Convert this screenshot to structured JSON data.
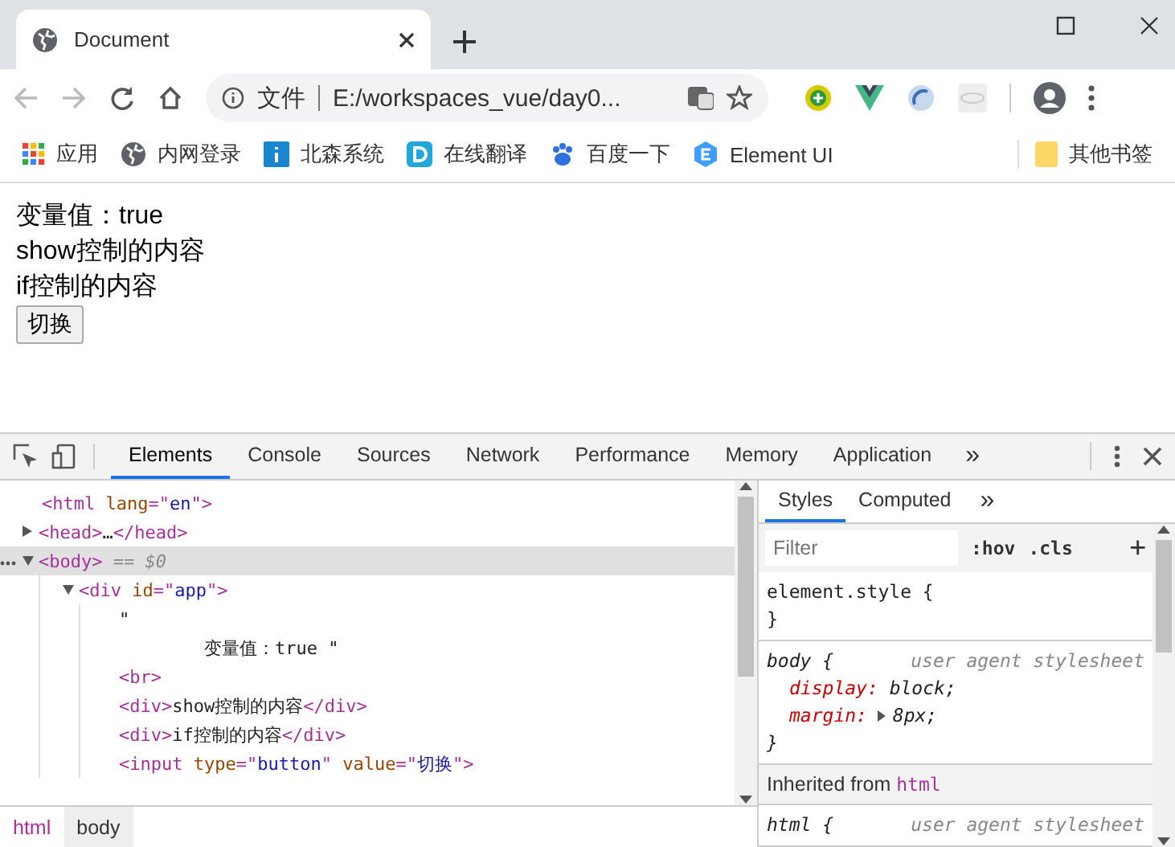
{
  "browser_tab": {
    "title": "Document"
  },
  "address_bar": {
    "scheme_label": "文件",
    "url": "E:/workspaces_vue/day0..."
  },
  "bookmarks": [
    {
      "kind": "apps",
      "label": "应用"
    },
    {
      "kind": "globe",
      "label": "内网登录"
    },
    {
      "kind": "info",
      "label": "北森系统"
    },
    {
      "kind": "letter-d",
      "label": "在线翻译"
    },
    {
      "kind": "paw",
      "label": "百度一下"
    },
    {
      "kind": "hex",
      "label": "Element UI"
    }
  ],
  "other_bookmarks": {
    "label": "其他书签"
  },
  "page": {
    "lines": [
      "变量值：true",
      "show控制的内容",
      "if控制的内容"
    ],
    "button": "切换"
  },
  "devtools": {
    "tabs": [
      {
        "label": "Elements",
        "selected": true
      },
      {
        "label": "Console",
        "selected": false
      },
      {
        "label": "Sources",
        "selected": false
      },
      {
        "label": "Network",
        "selected": false
      },
      {
        "label": "Performance",
        "selected": false
      },
      {
        "label": "Memory",
        "selected": false
      },
      {
        "label": "Application",
        "selected": false
      }
    ],
    "more_tabs": "»",
    "dom_tree": [
      {
        "parts": [
          {
            "kind": "tag",
            "text": "<html "
          },
          {
            "kind": "attr",
            "text": "lang"
          },
          {
            "kind": "tag",
            "text": "=\""
          },
          {
            "kind": "value",
            "text": "en"
          },
          {
            "kind": "tag",
            "text": "\">"
          }
        ],
        "selected": false,
        "children": [
          {
            "parts": [
              {
                "kind": "tag",
                "text": "<head>"
              },
              {
                "kind": "text",
                "text": "…"
              },
              {
                "kind": "tag",
                "text": "</head>"
              }
            ],
            "expanded": false,
            "selected": false
          },
          {
            "parts": [
              {
                "kind": "tag",
                "text": "<body>"
              },
              {
                "kind": "marker",
                "text": " == $0"
              }
            ],
            "expanded": true,
            "selected": true,
            "children": [
              {
                "parts": [
                  {
                    "kind": "tag",
                    "text": "<div "
                  },
                  {
                    "kind": "attr",
                    "text": "id"
                  },
                  {
                    "kind": "tag",
                    "text": "=\""
                  },
                  {
                    "kind": "value",
                    "text": "app"
                  },
                  {
                    "kind": "tag",
                    "text": "\">"
                  }
                ],
                "expanded": true,
                "selected": false,
                "children": [
                  {
                    "parts": [
                      {
                        "kind": "text",
                        "text": "\""
                      }
                    ],
                    "selected": false
                  },
                  {
                    "parts": [
                      {
                        "kind": "text",
                        "text": "        变量值：true \""
                      }
                    ],
                    "selected": false
                  },
                  {
                    "parts": [
                      {
                        "kind": "tag",
                        "text": "<br>"
                      }
                    ],
                    "selected": false
                  },
                  {
                    "parts": [
                      {
                        "kind": "tag",
                        "text": "<div>"
                      },
                      {
                        "kind": "text",
                        "text": "show控制的内容"
                      },
                      {
                        "kind": "tag",
                        "text": "</div>"
                      }
                    ],
                    "selected": false
                  },
                  {
                    "parts": [
                      {
                        "kind": "tag",
                        "text": "<div>"
                      },
                      {
                        "kind": "text",
                        "text": "if控制的内容"
                      },
                      {
                        "kind": "tag",
                        "text": "</div>"
                      }
                    ],
                    "selected": false
                  },
                  {
                    "parts": [
                      {
                        "kind": "tag",
                        "text": "<input "
                      },
                      {
                        "kind": "attr",
                        "text": "type"
                      },
                      {
                        "kind": "tag",
                        "text": "=\""
                      },
                      {
                        "kind": "value",
                        "text": "button"
                      },
                      {
                        "kind": "tag",
                        "text": "\" "
                      },
                      {
                        "kind": "attr",
                        "text": "value"
                      },
                      {
                        "kind": "tag",
                        "text": "=\""
                      },
                      {
                        "kind": "value",
                        "text": "切换"
                      },
                      {
                        "kind": "tag",
                        "text": "\">"
                      }
                    ],
                    "selected": false
                  }
                ]
              }
            ]
          }
        ]
      }
    ],
    "breadcrumbs": [
      {
        "label": "html",
        "selected": false
      },
      {
        "label": "body",
        "selected": true
      }
    ],
    "styles_tabs": [
      {
        "label": "Styles",
        "selected": true
      },
      {
        "label": "Computed",
        "selected": false
      }
    ],
    "styles_more": "»",
    "filter": {
      "placeholder": "Filter"
    },
    "filter_buttons": [
      ":hov",
      ".cls",
      "+"
    ],
    "rules": [
      {
        "kind": "rule",
        "selector": "element.style {",
        "close": "}"
      },
      {
        "kind": "rule",
        "selector": "body {",
        "source": "user agent stylesheet",
        "declarations": [
          {
            "property": "display:",
            "value": "block;",
            "expandable": false
          },
          {
            "property": "margin:",
            "value": "8px;",
            "expandable": true
          }
        ],
        "close": "}"
      },
      {
        "kind": "inherited",
        "label": "Inherited from",
        "target": "html"
      },
      {
        "kind": "rule",
        "selector": "html {",
        "source": "user agent stylesheet"
      }
    ]
  }
}
